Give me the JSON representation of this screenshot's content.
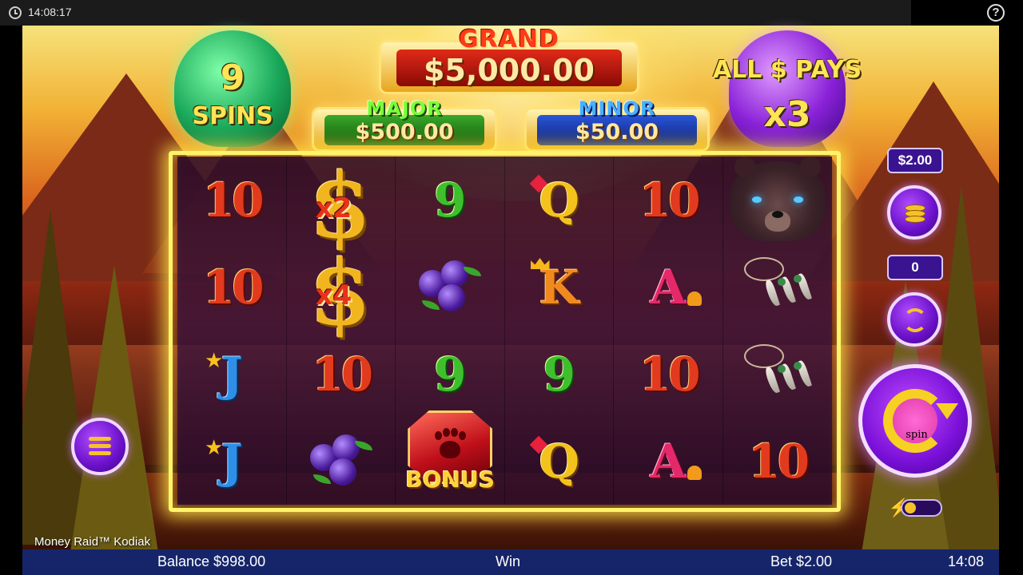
{
  "system_bar": {
    "time": "14:08:17",
    "help_symbol": "?"
  },
  "game": {
    "name": "Money Raid™ Kodiak"
  },
  "free_spins": {
    "count": "9",
    "label": "SPINS"
  },
  "all_pays": {
    "line1": "ALL $ PAYS",
    "multiplier": "x3"
  },
  "jackpots": {
    "grand": {
      "title": "GRAND",
      "value": "$5,000.00"
    },
    "major": {
      "title": "MAJOR",
      "value": "$500.00"
    },
    "minor": {
      "title": "MINOR",
      "value": "$50.00"
    }
  },
  "reels": [
    [
      "10",
      "10",
      "J",
      "J"
    ],
    [
      "$x2",
      "$x4",
      "10",
      "berries"
    ],
    [
      "9",
      "berries",
      "9",
      "bonus"
    ],
    [
      "Q",
      "K",
      "9",
      "Q"
    ],
    [
      "10",
      "A",
      "10",
      "A"
    ],
    [
      "bear",
      "claws",
      "claws",
      "10"
    ]
  ],
  "symbol_text": {
    "x2": "x2",
    "x4": "x4",
    "bonus": "BONUS"
  },
  "controls": {
    "bet_value": "$2.00",
    "autoplay_count": "0",
    "spin_label": "spin"
  },
  "bottom_bar": {
    "balance": "Balance $998.00",
    "win": "Win",
    "bet": "Bet $2.00",
    "clock": "14:08"
  },
  "colors": {
    "grand_band": "#b8150f",
    "major_band": "#1f7a1a",
    "minor_band": "#1a3aa0",
    "reel_frame": "#fff46a",
    "button_purple": "#7a10d8",
    "bottom_bar": "#16256a"
  }
}
